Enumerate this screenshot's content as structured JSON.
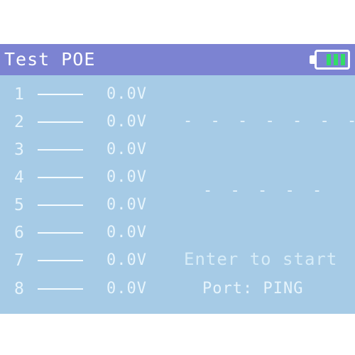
{
  "header": {
    "title": "Test POE",
    "battery": {
      "icon": "battery-icon",
      "bars": 3,
      "level": 1.0,
      "color": "#33dd66"
    }
  },
  "pins": [
    {
      "number": "1",
      "voltage": "0.0V"
    },
    {
      "number": "2",
      "voltage": "0.0V"
    },
    {
      "number": "3",
      "voltage": "0.0V"
    },
    {
      "number": "4",
      "voltage": "0.0V"
    },
    {
      "number": "5",
      "voltage": "0.0V"
    },
    {
      "number": "6",
      "voltage": "0.0V"
    },
    {
      "number": "7",
      "voltage": "0.0V"
    },
    {
      "number": "8",
      "voltage": "0.0V"
    }
  ],
  "status": {
    "line1": "- - - - - - -",
    "line2": "- - - - -",
    "prompt": "Enter to start",
    "port": "Port: PING"
  },
  "colors": {
    "screen": "#a6cbe6",
    "titlebar": "#7c83d2",
    "text": "#e6f4fc"
  }
}
